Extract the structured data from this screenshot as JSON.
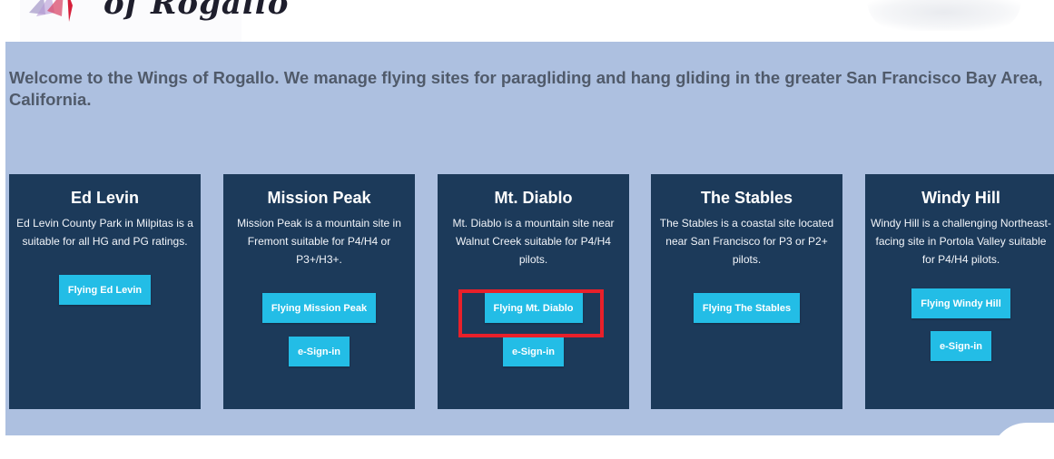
{
  "header": {
    "logo_text": "of Rogallo"
  },
  "welcome": {
    "text": "Welcome to the Wings of Rogallo. We manage flying sites for paragliding and hang gliding in the greater San Francisco Bay Area, California."
  },
  "sites": [
    {
      "title": "Ed Levin",
      "description": "Ed Levin County Park in Milpitas is a suitable for all HG and PG ratings.",
      "flying_label": "Flying Ed Levin",
      "esign_label": ""
    },
    {
      "title": "Mission Peak",
      "description": "Mission Peak is a mountain site in Fremont suitable for P4/H4 or P3+/H3+.",
      "flying_label": "Flying Mission Peak",
      "esign_label": "e-Sign-in"
    },
    {
      "title": "Mt. Diablo",
      "description": "Mt. Diablo is a mountain site near Walnut Creek suitable for P4/H4 pilots.",
      "flying_label": "Flying Mt. Diablo",
      "esign_label": "e-Sign-in"
    },
    {
      "title": "The Stables",
      "description": "The Stables is a coastal site located near San Francisco for P3 or P2+ pilots.",
      "flying_label": "Flying The Stables",
      "esign_label": ""
    },
    {
      "title": "Windy Hill",
      "description": "Windy Hill is a challenging Northeast-facing site in Portola Valley suitable for P4/H4 pilots.",
      "flying_label": "Flying Windy Hill",
      "esign_label": "e-Sign-in"
    }
  ],
  "colors": {
    "page_background": "#adc0e0",
    "card_background": "#1c3a5a",
    "button": "#23bde6",
    "highlight_box": "#e8202a"
  },
  "icons": {
    "logo": "wing-logo-icon"
  }
}
